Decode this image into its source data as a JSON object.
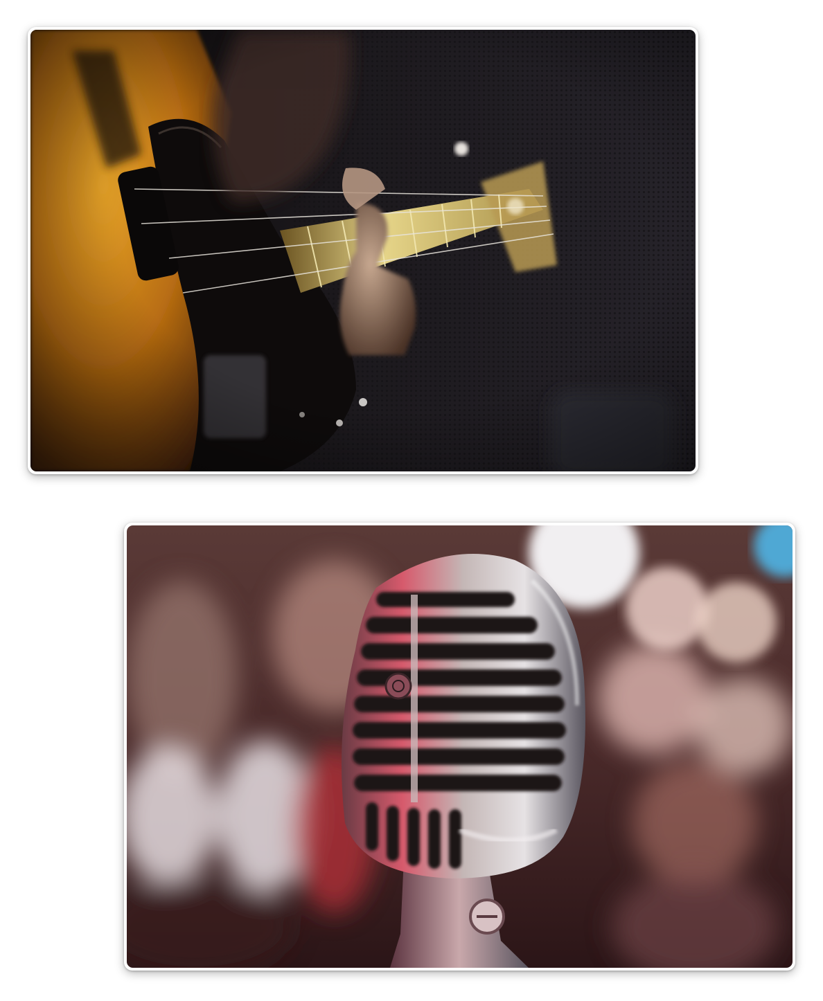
{
  "photos": [
    {
      "subject": "bass-guitar-photo"
    },
    {
      "subject": "vintage-microphone-photo"
    }
  ]
}
